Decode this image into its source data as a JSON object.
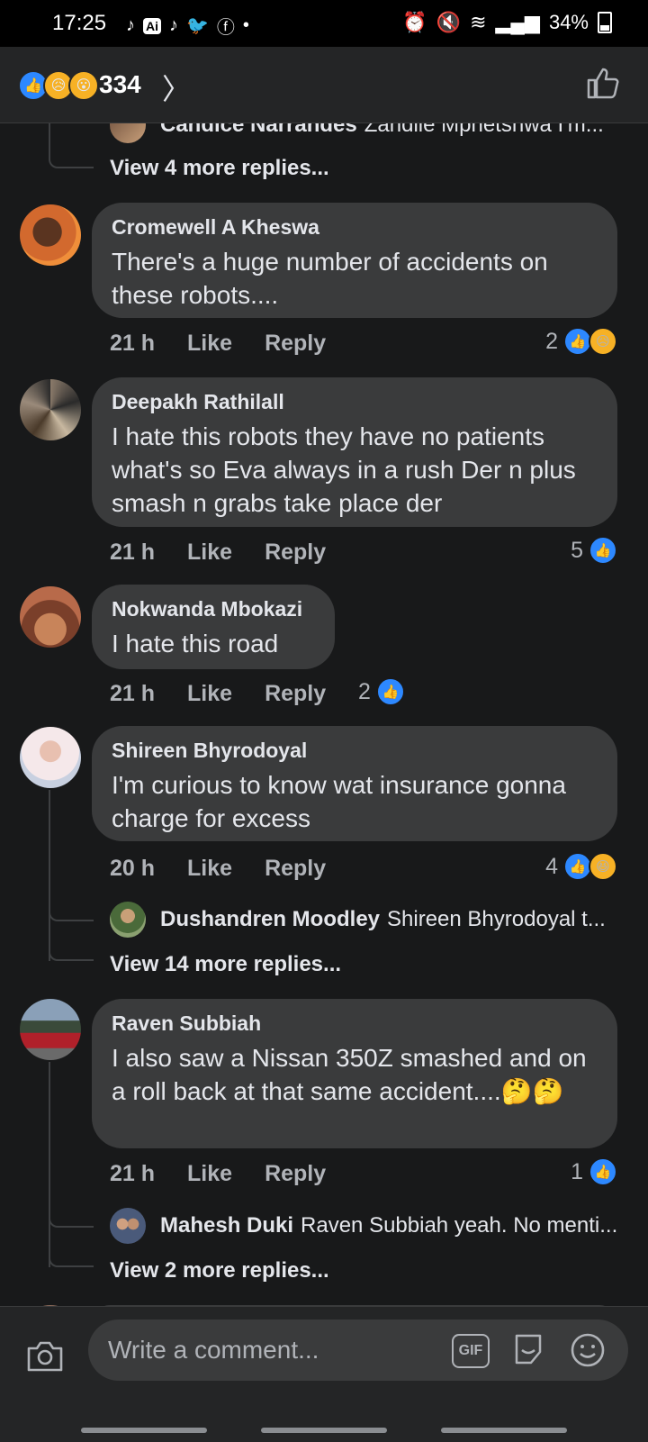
{
  "status_bar": {
    "time": "17:25",
    "battery": "34%",
    "ai_badge": "Ai"
  },
  "header": {
    "reaction_count": "334"
  },
  "top_partial": {
    "name": "Candice Narrandes",
    "text": "Zandile Mphetshwa I'm...",
    "view_more": "View 4 more replies..."
  },
  "comments": [
    {
      "name": "Cromewell A Kheswa",
      "text": "There's a huge number of accidents on these robots....",
      "time": "21 h",
      "like": "Like",
      "reply": "Reply",
      "reaction_count": "2",
      "reactions": [
        "like",
        "sad"
      ]
    },
    {
      "name": "Deepakh Rathilall",
      "text": "I hate this robots they  have no patients what's so Eva always in a rush Der n plus smash n grabs take place der",
      "time": "21 h",
      "like": "Like",
      "reply": "Reply",
      "reaction_count": "5",
      "reactions": [
        "like"
      ]
    },
    {
      "name": "Nokwanda Mbokazi",
      "text": "I hate this road",
      "time": "21 h",
      "like": "Like",
      "reply": "Reply",
      "reaction_count": "2",
      "reactions": [
        "like"
      ]
    },
    {
      "name": "Shireen Bhyrodoyal",
      "text": "I'm curious to know wat insurance gonna charge for excess",
      "time": "20 h",
      "like": "Like",
      "reply": "Reply",
      "reaction_count": "4",
      "reactions": [
        "like",
        "haha"
      ],
      "reply_preview": {
        "name": "Dushandren Moodley",
        "text": "Shireen Bhyrodoyal t..."
      },
      "view_more": "View 14 more replies..."
    },
    {
      "name": "Raven Subbiah",
      "text": "I also saw a Nissan 350Z smashed and on a roll back at that same accident....🤔🤔",
      "time": "21 h",
      "like": "Like",
      "reply": "Reply",
      "reaction_count": "1",
      "reactions": [
        "like"
      ],
      "reply_preview": {
        "name": "Mahesh Duki",
        "text": "Raven Subbiah yeah. No menti..."
      },
      "view_more": "View 2 more replies..."
    }
  ],
  "composer": {
    "placeholder": "Write a comment...",
    "gif_label": "GIF"
  },
  "colors": {
    "like_blue": "#2d88ff",
    "reaction_yellow": "#f7b125",
    "bubble_bg": "#3a3b3c",
    "page_bg": "#18191a"
  }
}
